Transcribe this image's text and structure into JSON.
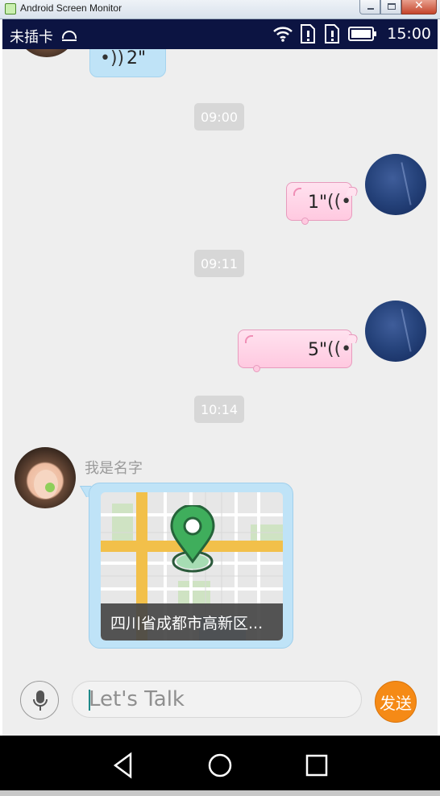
{
  "window": {
    "title": "Android Screen Monitor"
  },
  "status_bar": {
    "carrier": "未插卡",
    "time": "15:00"
  },
  "messages": [
    {
      "side": "left",
      "type": "voice",
      "duration": "2\""
    },
    {
      "type": "time",
      "text": "09:00"
    },
    {
      "side": "right",
      "type": "voice",
      "duration": "1\""
    },
    {
      "type": "time",
      "text": "09:11"
    },
    {
      "side": "right",
      "type": "voice",
      "duration": "5\""
    },
    {
      "type": "time",
      "text": "10:14"
    },
    {
      "side": "left",
      "type": "location",
      "sender_name": "我是名字",
      "address": "四川省成都市高新区..."
    }
  ],
  "input_bar": {
    "placeholder": "Let's Talk",
    "send_label": "发送"
  },
  "colors": {
    "status_bar": "#0c1442",
    "chat_bg": "#eeeeee",
    "bubble_blue": "#bfe3f7",
    "bubble_pink": "#ffd3e6",
    "time_chip": "#d7d7d7",
    "send_button": "#f58a16"
  },
  "icons": {
    "status": [
      "android-icon",
      "wifi-icon",
      "sim-icon",
      "sim-icon",
      "battery-icon"
    ],
    "nav": [
      "back-icon",
      "home-icon",
      "recents-icon"
    ]
  }
}
